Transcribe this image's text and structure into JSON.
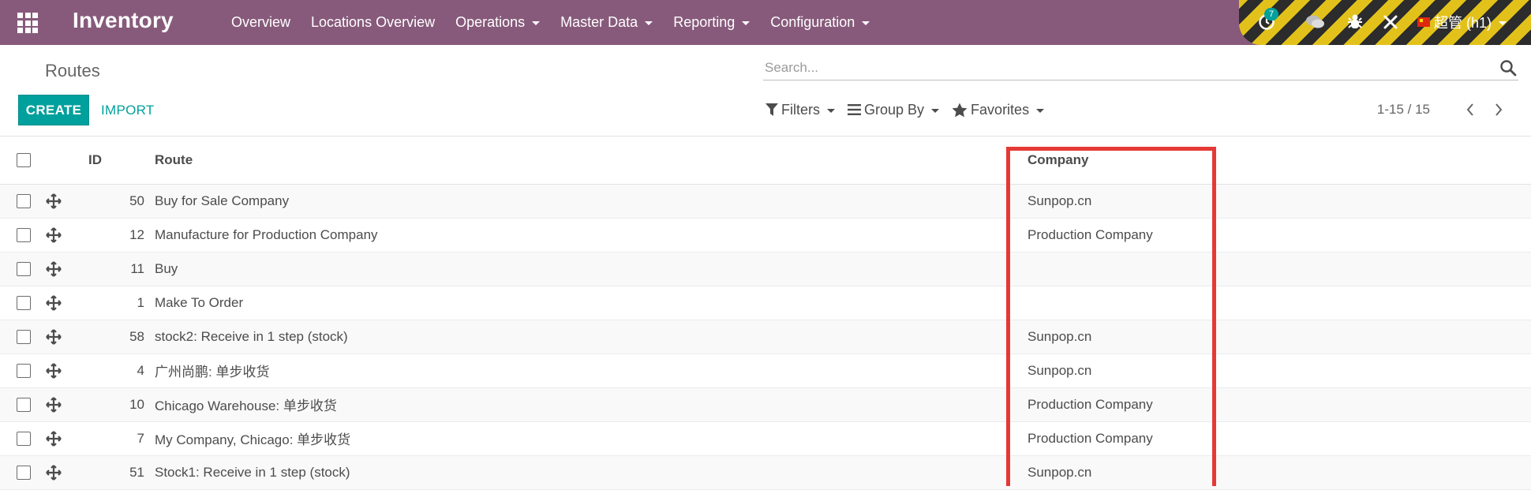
{
  "app": {
    "title": "Inventory",
    "menu": [
      {
        "label": "Overview",
        "dropdown": false
      },
      {
        "label": "Locations Overview",
        "dropdown": false
      },
      {
        "label": "Operations",
        "dropdown": true
      },
      {
        "label": "Master Data",
        "dropdown": true
      },
      {
        "label": "Reporting",
        "dropdown": true
      },
      {
        "label": "Configuration",
        "dropdown": true
      }
    ],
    "systray": {
      "activity_count": "7",
      "user": "超管 (h1)"
    },
    "colors": {
      "navbar": "#875a7b",
      "primary": "#00a09d",
      "highlight": "#e53935"
    }
  },
  "control_panel": {
    "breadcrumb": "Routes",
    "search_placeholder": "Search...",
    "create_label": "CREATE",
    "import_label": "IMPORT",
    "filters_label": "Filters",
    "groupby_label": "Group By",
    "favorites_label": "Favorites",
    "pager": "1-15 / 15"
  },
  "list": {
    "columns": {
      "id": "ID",
      "route": "Route",
      "company": "Company"
    },
    "rows": [
      {
        "id": "50",
        "route": "Buy for Sale Company",
        "company": "Sunpop.cn"
      },
      {
        "id": "12",
        "route": "Manufacture for Production Company",
        "company": "Production Company"
      },
      {
        "id": "11",
        "route": "Buy",
        "company": ""
      },
      {
        "id": "1",
        "route": "Make To Order",
        "company": ""
      },
      {
        "id": "58",
        "route": "stock2: Receive in 1 step (stock)",
        "company": "Sunpop.cn"
      },
      {
        "id": "4",
        "route": "广州尚鹏: 单步收货",
        "company": "Sunpop.cn"
      },
      {
        "id": "10",
        "route": "Chicago Warehouse: 单步收货",
        "company": "Production Company"
      },
      {
        "id": "7",
        "route": "My Company, Chicago: 单步收货",
        "company": "Production Company"
      },
      {
        "id": "51",
        "route": "Stock1: Receive in 1 step (stock)",
        "company": "Sunpop.cn"
      }
    ]
  }
}
